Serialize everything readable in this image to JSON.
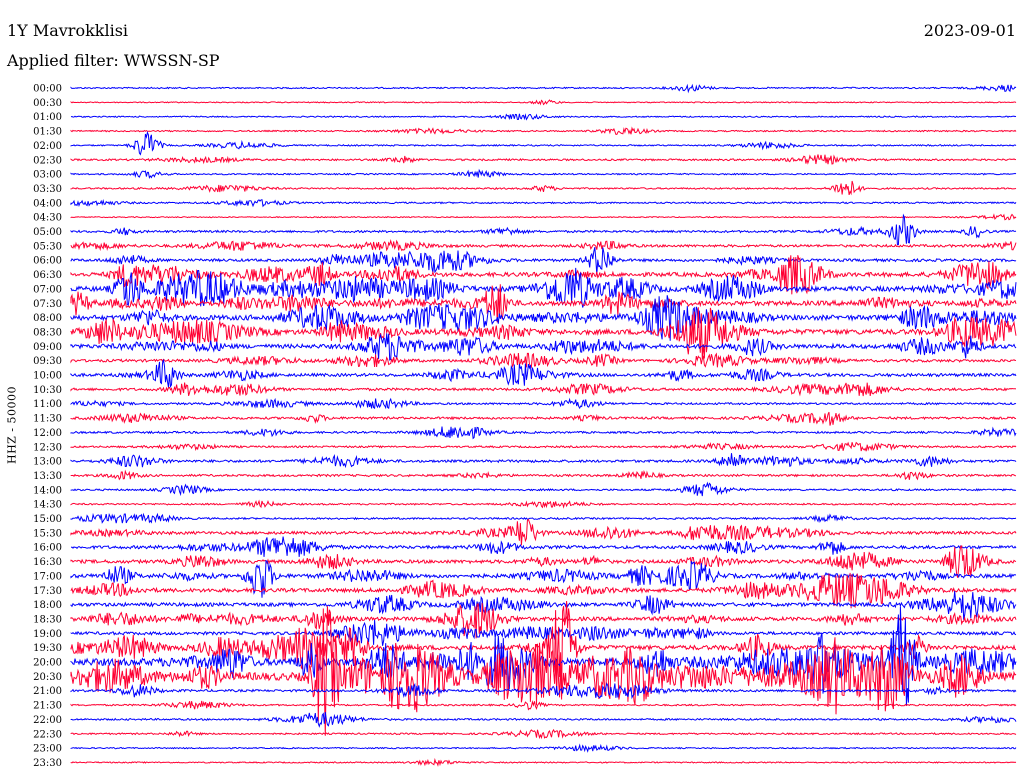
{
  "header": {
    "station": "1Y Mavrokklisi",
    "date": "2023-09-01",
    "filter": "Applied filter: WWSSN-SP"
  },
  "channel_label": "HHZ - 50000",
  "colors": {
    "odd_row": "#0000ff",
    "even_row": "#ff0033",
    "text": "#000000"
  },
  "chart_data": {
    "type": "helicorder",
    "y_tick_labels": [
      "00:00",
      "00:30",
      "01:00",
      "01:30",
      "02:00",
      "02:30",
      "03:00",
      "03:30",
      "04:00",
      "04:30",
      "05:00",
      "05:30",
      "06:00",
      "06:30",
      "07:00",
      "07:30",
      "08:00",
      "08:30",
      "09:00",
      "09:30",
      "10:00",
      "10:30",
      "11:00",
      "11:30",
      "12:00",
      "12:30",
      "13:00",
      "13:30",
      "14:00",
      "14:30",
      "15:00",
      "15:30",
      "16:00",
      "16:30",
      "17:00",
      "17:30",
      "18:00",
      "18:30",
      "19:00",
      "19:30",
      "20:00",
      "20:30",
      "21:00",
      "21:30",
      "22:00",
      "22:30",
      "23:00",
      "23:30"
    ],
    "ylabel": "HHZ - 50000",
    "row_colors": [
      "blue",
      "red"
    ],
    "amplitude_scale": 50000,
    "row_activity": [
      0.3,
      0.1,
      0.2,
      0.3,
      0.3,
      0.5,
      0.3,
      0.4,
      0.4,
      0.1,
      0.7,
      0.9,
      1.0,
      1.8,
      2.2,
      2.0,
      2.3,
      2.3,
      1.8,
      1.0,
      1.2,
      0.9,
      0.6,
      0.8,
      0.6,
      0.5,
      0.9,
      0.7,
      0.5,
      0.4,
      0.5,
      1.1,
      1.2,
      1.4,
      1.6,
      1.6,
      1.5,
      1.6,
      1.2,
      2.0,
      3.5,
      3.8,
      0.8,
      0.4,
      0.5,
      0.4,
      0.2,
      0.2
    ],
    "events": [
      {
        "row": 4,
        "at": 0.08,
        "amp": 14
      },
      {
        "row": 7,
        "at": 0.82,
        "amp": 10
      },
      {
        "row": 10,
        "at": 0.88,
        "amp": 16
      },
      {
        "row": 12,
        "at": 0.56,
        "amp": 16
      },
      {
        "row": 14,
        "at": 0.06,
        "amp": 16
      },
      {
        "row": 15,
        "at": 0.45,
        "amp": 20
      },
      {
        "row": 20,
        "at": 0.1,
        "amp": 14
      },
      {
        "row": 26,
        "at": 0.7,
        "amp": 10
      },
      {
        "row": 31,
        "at": 0.48,
        "amp": 14
      },
      {
        "row": 33,
        "at": 0.94,
        "amp": 14
      },
      {
        "row": 34,
        "at": 0.2,
        "amp": 24
      },
      {
        "row": 39,
        "at": 0.52,
        "amp": 60
      },
      {
        "row": 40,
        "at": 0.88,
        "amp": 50
      },
      {
        "row": 41,
        "at": 0.27,
        "amp": 70
      }
    ]
  }
}
